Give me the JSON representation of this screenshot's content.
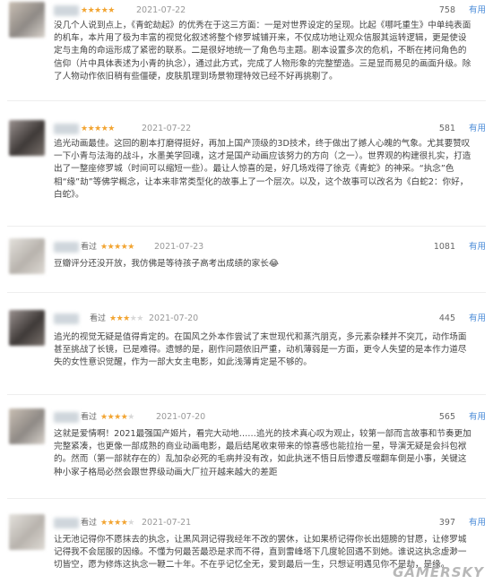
{
  "reviews": [
    {
      "seen_label": "",
      "stars": 5,
      "date": "2021-07-22",
      "useful_count": "758",
      "useful_label": "有用",
      "text": "没几个人说到点上，《青蛇劫起》的优秀在于这三方面：一是对世界设定的呈现。比起《哪吒重生》中单纯表面的机车，本片用了极为丰富的视觉化叙述将整个修罗城铺开来，不仅成功地让观众信服其运转逻辑，更是使设定与主角的命运形成了紧密的联系。二是很好地统一了角色与主题。剧本设置多次的危机，不断在拷问角色的信仰（片中具体表述为小青的执念），通过此方式，完成了人物形象的完整塑造。三是显而易见的画面升级。除了人物动作依旧稍有些僵硬，皮肤肌理到场景物理特效已经不好再挑剔了。"
    },
    {
      "seen_label": "",
      "stars": 5,
      "date": "2021-07-22",
      "useful_count": "581",
      "useful_label": "有用",
      "text": "追光动画最佳。这回的剧本打磨得挺好，再加上国产顶级的3D技术，终于做出了撼人心魄的气象。尤其要赞叹一下小青与法海的战斗，水墨美学回魂，这才是国产动画应该努力的方向（之一）。世界观的构建很扎实，打造出了一整座修罗城（时间可以缩短一些）。最让人惊喜的是，好几场戏得了徐克《青蛇》的神采。“执念”色相“缘”劫”等佛学概念，让本来非常类型化的故事上了一个层次。以及，这个故事可以改名为《白蛇2：你好，白蛇》。"
    },
    {
      "seen_label": "看过",
      "stars": 5,
      "date": "2021-07-23",
      "useful_count": "1081",
      "useful_label": "有用",
      "text": "豆瓣评分还没开放，我仿佛是等待孩子高考出成绩的家长😂"
    },
    {
      "seen_label": "看过",
      "stars": 3,
      "date": "2021-07-20",
      "useful_count": "445",
      "useful_label": "有用",
      "text": "追光的视觉无疑是值得肯定的。在国风之外本作尝试了末世现代和蒸汽朋克，多元素杂糅并不突兀，动作场面甚至挑战了长镜，已是难得。遗憾的是，剧作问题依旧严重，动机薄弱是一方面，更令人失望的是本作力道尽失的女性意识觉醒，作为一部大女主电影，如此浅薄肯定是不够的。"
    },
    {
      "seen_label": "看过",
      "stars": 4,
      "date": "2021-07-20",
      "useful_count": "565",
      "useful_label": "有用",
      "text": "这就是爱情啊！2021最强国产姬片，看完大动地……追光的技术真心叹为观止，较第一部而言故事和节奏更加完整紧凑，也更像一部成熟的商业动画电影，最后结尾收束带来的惊喜感也能拉抬一星，导演无疑是会抖包袱的。然而（第一部就存在的）乱加杂必死的毛病并没有改，如此执迷不悟日后惨遭反噬翻车倒是小事，关键这种小家子格局必然会跟世界级动画大厂拉开越来越大的差距"
    },
    {
      "seen_label": "看过",
      "stars": 4,
      "date": "2021-07-21",
      "useful_count": "397",
      "useful_label": "有用",
      "text": "让无池记得你不愿抹去的执念，让黑风洞记得我经年不改的罢休，让如果桥记得你长出翅膀的甘愿，让修罗城记得我不会屈服的因缘。不懂为何最苦最恐是求而不得，直到雷峰塔下几度轮回遇不到她。谁说这执念虚渺一切皆空，愿为修炼这执念一鞭二十年。不在乎记忆全无，爱到最后一生，只想证明遇见你不是劫，是缘。"
    }
  ],
  "watermark": "GAMERSKY"
}
